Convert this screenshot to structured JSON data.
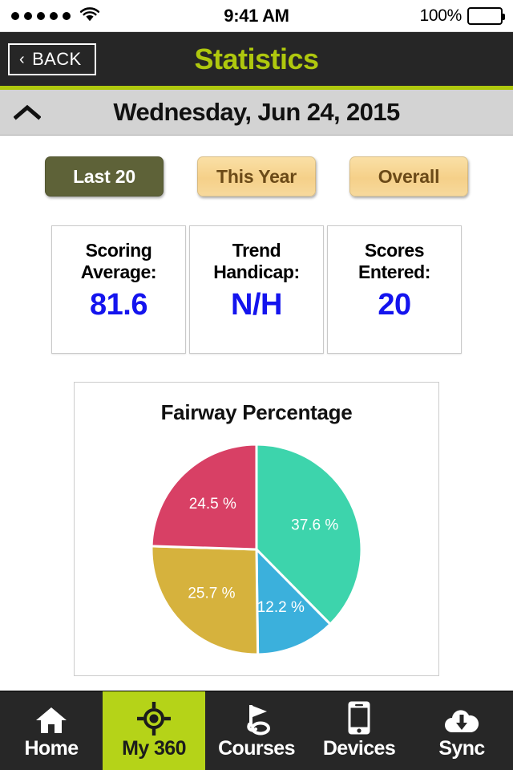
{
  "statusbar": {
    "signal_icon": "signal-dots-icon",
    "signal_dots": 5,
    "wifi_icon": "wifi-icon",
    "time": "9:41 AM",
    "battery_percent": "100%",
    "battery_icon": "battery-full-icon"
  },
  "navbar": {
    "back_label": "BACK",
    "back_chevron": "‹",
    "title": "Statistics",
    "title_color": "#AFC80E",
    "background_color": "#262626"
  },
  "datebar": {
    "collapse_icon": "chevron-up-icon",
    "date": "Wednesday, Jun 24, 2015"
  },
  "filters": [
    {
      "label": "Last 20",
      "active": true
    },
    {
      "label": "This Year",
      "active": false
    },
    {
      "label": "Overall",
      "active": false
    }
  ],
  "stats": [
    {
      "label": "Scoring\nAverage:",
      "label_line1": "Scoring",
      "label_line2": "Average:",
      "value": "81.6"
    },
    {
      "label": "Trend\nHandicap:",
      "label_line1": "Trend",
      "label_line2": "Handicap:",
      "value": "N/H"
    },
    {
      "label": "Scores\nEntered:",
      "label_line1": "Scores",
      "label_line2": "Entered:",
      "value": "20"
    }
  ],
  "stat_value_color": "#1414EE",
  "chart_data": {
    "type": "pie",
    "title": "Fairway Percentage",
    "categories": [
      "37.6 %",
      "12.2 %",
      "25.7 %",
      "24.5 %"
    ],
    "labels": [
      "37.6 %",
      "12.2 %",
      "25.7 %",
      "24.5 %"
    ],
    "values": [
      37.6,
      12.2,
      25.7,
      24.5
    ],
    "colors": [
      "#3DD4AC",
      "#3BB0DC",
      "#D6B23D",
      "#D84065"
    ],
    "start_angle_deg": 0,
    "direction": "clockwise",
    "label_color": "#ffffff",
    "slice_gap_color": "#ffffff",
    "legend": "none",
    "units": "percent"
  },
  "tabs": [
    {
      "label": "Home",
      "icon": "home-icon",
      "active": false
    },
    {
      "label": "My 360",
      "icon": "target-crosshair-icon",
      "active": true
    },
    {
      "label": "Courses",
      "icon": "golf-flag-hole-icon",
      "active": false
    },
    {
      "label": "Devices",
      "icon": "phone-icon",
      "active": false
    },
    {
      "label": "Sync",
      "icon": "cloud-download-icon",
      "active": false
    }
  ],
  "tab_active_color": "#B5D318"
}
